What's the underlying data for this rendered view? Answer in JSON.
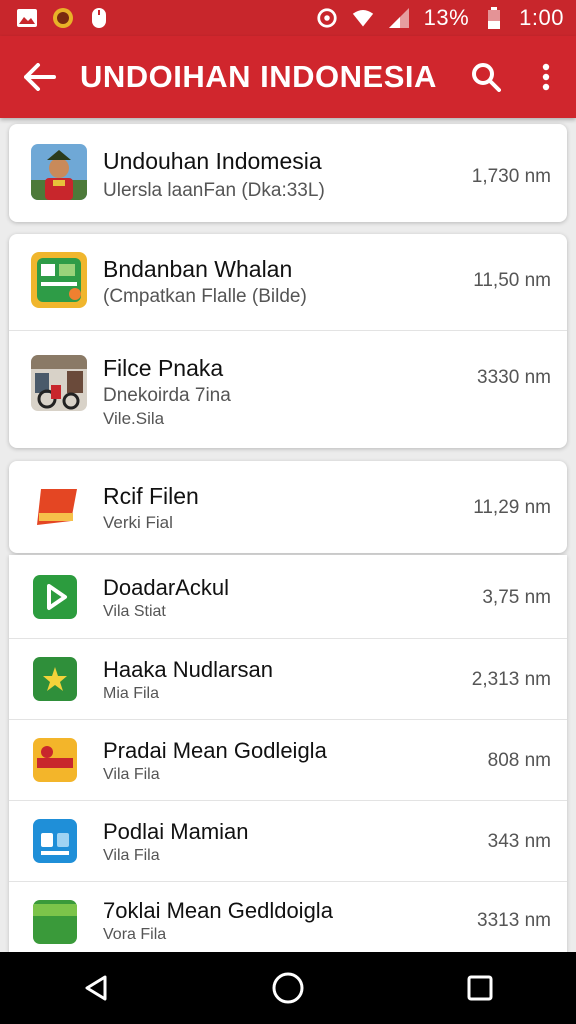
{
  "status_bar": {
    "battery_text": "13%",
    "time": "1:00",
    "icons": [
      "gallery-icon",
      "badge-icon",
      "mouse-icon",
      "target-icon",
      "wifi-icon",
      "signal-icon",
      "battery-icon"
    ]
  },
  "app_bar": {
    "title": "UNDOIHAN INDONESIA",
    "back_icon": "arrow-left-icon",
    "search_icon": "search-icon",
    "menu_icon": "more-vert-icon"
  },
  "cards": [
    {
      "items": [
        {
          "title": "Undouhan Indomesia",
          "sub1": "Ulersla laanFan (Dka:33L)",
          "sub2": "",
          "size": "1,730 nm",
          "thumb": "portrait"
        }
      ]
    },
    {
      "items": [
        {
          "title": "Bndanban Whalan",
          "sub1": "(Cmpatkan Flalle (Bilde)",
          "sub2": "",
          "size": "11,50 nm",
          "thumb": "green-app"
        },
        {
          "title": "Filce Pnaka",
          "sub1": "Dnekoirda 7ina",
          "sub2": "Vile.Sila",
          "size": "3330 nm",
          "thumb": "photo"
        }
      ]
    },
    {
      "items": [
        {
          "title": "Rcif Filen",
          "sub1": "Verki Fial",
          "sub2": "",
          "size": "11,29 nm",
          "thumb": "red-tag"
        }
      ]
    }
  ],
  "list": [
    {
      "title": "DoadarAckul",
      "sub1": "Vila Stiat",
      "size": "3,75 nm",
      "thumb": "play"
    },
    {
      "title": "Haaka Nudlarsan",
      "sub1": "Mia Fila",
      "size": "2,313 nm",
      "thumb": "green-star"
    },
    {
      "title": "Pradai Mean Godleigla",
      "sub1": "Vila Fila",
      "size": "808 nm",
      "thumb": "orange-logo"
    },
    {
      "title": "Podlai Mamian",
      "sub1": "Vila Fila",
      "size": "343 nm",
      "thumb": "blue-app"
    },
    {
      "title": "7oklai Mean Gedldoigla",
      "sub1": "Vora Fila",
      "size": "3313 nm",
      "thumb": "green-banner"
    }
  ],
  "nav_bar": {
    "back": "nav-back-icon",
    "home": "nav-home-icon",
    "recents": "nav-recents-icon"
  },
  "colors": {
    "primary": "#d0262d",
    "status": "#c8262c",
    "background": "#ececec"
  }
}
